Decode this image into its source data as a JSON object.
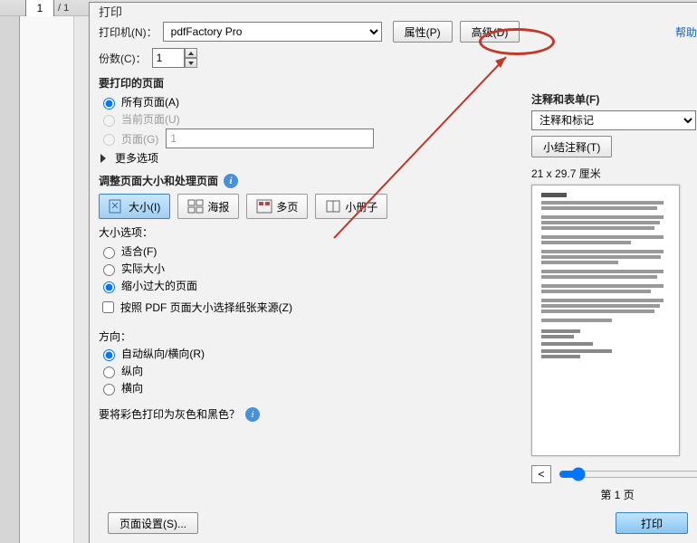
{
  "toolbar": {
    "page_input": "1",
    "page_total": "/ 1"
  },
  "dialog": {
    "title": "打印",
    "printer": {
      "label": "打印机(N)：",
      "value": "pdfFactory Pro",
      "props_btn": "属性(P)",
      "adv_btn": "高级(D)"
    },
    "copies": {
      "label": "份数(C)：",
      "value": "1"
    },
    "help_link": "帮助",
    "pages_section": {
      "title": "要打印的页面",
      "all_pages": "所有页面(A)",
      "current_page": "当前页面(U)",
      "page_range": "页面(G)",
      "page_range_value": "1",
      "more_options": "更多选项"
    },
    "size_section": {
      "title": "调整页面大小和处理页面",
      "btn_size": "大小(I)",
      "btn_poster": "海报",
      "btn_multi": "多页",
      "btn_booklet": "小册子",
      "size_options_title": "大小选项：",
      "fit": "适合(F)",
      "actual": "实际大小",
      "shrink": "缩小过大的页面",
      "paper_source": "按照 PDF 页面大小选择纸张来源(Z)"
    },
    "orient_section": {
      "title": "方向：",
      "auto": "自动纵向/横向(R)",
      "portrait": "纵向",
      "landscape": "横向"
    },
    "grayscale": "要将彩色打印为灰色和黑色？",
    "comments_section": {
      "title": "注释和表单(F)",
      "dropdown_value": "注释和标记",
      "summarize_btn": "小结注释(T)"
    },
    "preview": {
      "dimensions": "21 x 29.7 厘米",
      "page_label": "第 1 页",
      "nav_prev": "<"
    },
    "page_setup_btn": "页面设置(S)...",
    "print_btn": "打印"
  }
}
